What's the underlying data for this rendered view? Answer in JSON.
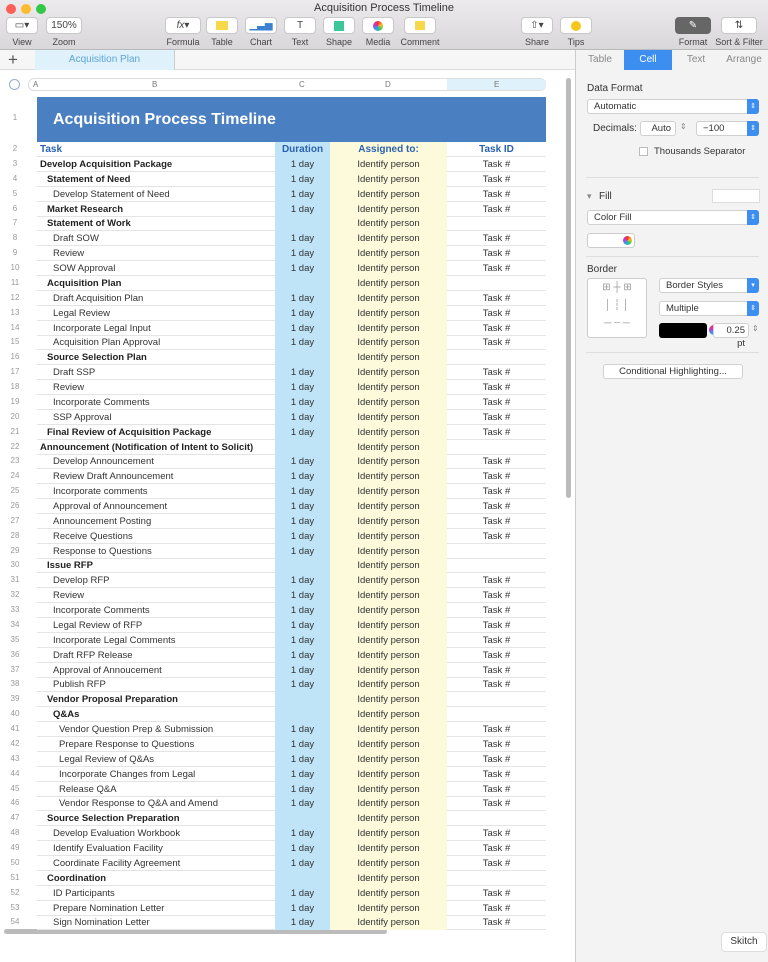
{
  "window": {
    "title": "Acquisition Process Timeline"
  },
  "toolbar": {
    "view": "View",
    "zoom_value": "150%",
    "zoom": "Zoom",
    "formula": "Formula",
    "table": "Table",
    "chart": "Chart",
    "text": "Text",
    "shape": "Shape",
    "media": "Media",
    "comment": "Comment",
    "share": "Share",
    "tips": "Tips",
    "format": "Format",
    "sort_filter": "Sort & Filter"
  },
  "sheet_tab": "Acquisition Plan",
  "columns": [
    "A",
    "B",
    "C",
    "D",
    "E"
  ],
  "sheet": {
    "title": "Acquisition Process Timeline",
    "headers": {
      "task": "Task",
      "duration": "Duration",
      "assigned": "Assigned to:",
      "taskid": "Task ID"
    },
    "rows": [
      [
        "Develop Acquisition Package",
        0,
        "1 day",
        "Task #"
      ],
      [
        "Statement of Need",
        1,
        "1 day",
        "Task #"
      ],
      [
        "Develop Statement of Need",
        2,
        "1 day",
        "Task #"
      ],
      [
        "Market Research",
        1,
        "1 day",
        "Task #"
      ],
      [
        "Statement of Work",
        1,
        "",
        ""
      ],
      [
        "Draft SOW",
        2,
        "1 day",
        "Task #"
      ],
      [
        "Review",
        2,
        "1 day",
        "Task #"
      ],
      [
        "SOW Approval",
        2,
        "1 day",
        "Task #"
      ],
      [
        "Acquisition Plan",
        1,
        "",
        ""
      ],
      [
        "Draft Acquisition Plan",
        2,
        "1 day",
        "Task #"
      ],
      [
        "Legal Review",
        2,
        "1 day",
        "Task #"
      ],
      [
        "Incorporate Legal Input",
        2,
        "1 day",
        "Task #"
      ],
      [
        "Acquisition Plan Approval",
        2,
        "1 day",
        "Task #"
      ],
      [
        "Source Selection Plan",
        1,
        "",
        ""
      ],
      [
        "Draft SSP",
        2,
        "1 day",
        "Task #"
      ],
      [
        "Review",
        2,
        "1 day",
        "Task #"
      ],
      [
        "Incorporate Comments",
        2,
        "1 day",
        "Task #"
      ],
      [
        "SSP Approval",
        2,
        "1 day",
        "Task #"
      ],
      [
        "Final Review of Acquisition Package",
        1,
        "1 day",
        "Task #"
      ],
      [
        "Announcement (Notification of Intent to Solicit)",
        0,
        "",
        ""
      ],
      [
        "Develop Announcement",
        2,
        "1 day",
        "Task #"
      ],
      [
        "Review Draft Announcement",
        2,
        "1 day",
        "Task #"
      ],
      [
        "Incorporate comments",
        2,
        "1 day",
        "Task #"
      ],
      [
        "Approval of Announcement",
        2,
        "1 day",
        "Task #"
      ],
      [
        "Announcement Posting",
        2,
        "1 day",
        "Task #"
      ],
      [
        "Receive Questions",
        2,
        "1 day",
        "Task #"
      ],
      [
        "Response to Questions",
        2,
        "1 day",
        ""
      ],
      [
        "Issue RFP",
        1,
        "",
        ""
      ],
      [
        "Develop RFP",
        2,
        "1 day",
        "Task #"
      ],
      [
        "Review",
        2,
        "1 day",
        "Task #"
      ],
      [
        "Incorporate Comments",
        2,
        "1 day",
        "Task #"
      ],
      [
        "Legal Review of RFP",
        2,
        "1 day",
        "Task #"
      ],
      [
        "Incorporate Legal Comments",
        2,
        "1 day",
        "Task #"
      ],
      [
        "Draft RFP Release",
        2,
        "1 day",
        "Task #"
      ],
      [
        "Approval of Annoucement",
        2,
        "1 day",
        "Task #"
      ],
      [
        "Publish RFP",
        2,
        "1 day",
        "Task #"
      ],
      [
        "Vendor Proposal Preparation",
        1,
        "",
        ""
      ],
      [
        "Q&As",
        4,
        "",
        ""
      ],
      [
        "Vendor Question Prep & Submission",
        3,
        "1 day",
        "Task #"
      ],
      [
        "Prepare Response to Questions",
        3,
        "1 day",
        "Task #"
      ],
      [
        "Legal Review of Q&As",
        3,
        "1 day",
        "Task #"
      ],
      [
        "Incorporate Changes from Legal",
        3,
        "1 day",
        "Task #"
      ],
      [
        "Release Q&A",
        3,
        "1 day",
        "Task #"
      ],
      [
        "Vendor Response to Q&A and Amend",
        3,
        "1 day",
        "Task #"
      ],
      [
        "Source Selection Preparation",
        1,
        "",
        ""
      ],
      [
        "Develop Evaluation Workbook",
        2,
        "1 day",
        "Task #"
      ],
      [
        "Identify Evaluation Facility",
        2,
        "1 day",
        "Task #"
      ],
      [
        "Coordinate Facility Agreement",
        2,
        "1 day",
        "Task #"
      ],
      [
        "Coordination",
        1,
        "",
        ""
      ],
      [
        "ID Participants",
        2,
        "1 day",
        "Task #"
      ],
      [
        "Prepare Nomination Letter",
        2,
        "1 day",
        "Task #"
      ],
      [
        "Sign Nomination Letter",
        2,
        "1 day",
        "Task #"
      ]
    ],
    "assigned_value": "Identify person"
  },
  "panel": {
    "tabs": [
      "Table",
      "Cell",
      "Text",
      "Arrange"
    ],
    "data_format": "Data Format",
    "format_value": "Automatic",
    "decimals": "Decimals:",
    "decimals_value": "Auto",
    "neg_value": "−100",
    "thousands": "Thousands Separator",
    "fill": "Fill",
    "fill_value": "Color Fill",
    "border": "Border",
    "border_styles": "Border Styles",
    "border_multiple": "Multiple",
    "border_width": "0.25 pt",
    "conditional": "Conditional Highlighting..."
  },
  "skitch": "Skitch",
  "colors": {
    "accent": "#3c8ef0",
    "title_bg": "#4a7fc1",
    "duration_bg": "#bfe3f7",
    "assigned_bg": "#fdfadc"
  }
}
